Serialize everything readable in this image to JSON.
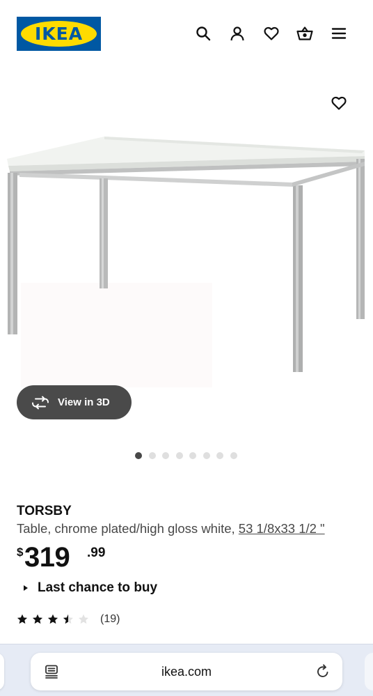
{
  "header": {
    "logo_text": "IKEA",
    "icons": [
      "search-icon",
      "account-icon",
      "heart-icon",
      "basket-icon",
      "menu-icon"
    ]
  },
  "hero": {
    "image_name": "table-product-image",
    "favorite_icon": "heart-icon",
    "view3d_label": "View in 3D",
    "view3d_icon": "rotate-3d-icon",
    "carousel": {
      "total": 8,
      "active": 1
    }
  },
  "product": {
    "name": "TORSBY",
    "description": "Table, chrome plated/high gloss white,",
    "size_link": "53 1/8x33 1/2 \"",
    "price": {
      "currency": "$",
      "integer": "319",
      "decimal": ".99"
    },
    "availability": "Last chance to buy",
    "rating": {
      "stars": 3.5,
      "max": 5,
      "count_label": "(19)"
    }
  },
  "browser": {
    "domain": "ikea.com",
    "icons": [
      "reader-menu-icon",
      "reload-icon"
    ]
  },
  "colors": {
    "ikea_blue": "#0058a3",
    "ikea_yellow": "#ffdb00",
    "text": "#111111",
    "secondary_text": "#484848",
    "view3d_bg": "#4a4a4a",
    "dot_active": "#484848",
    "dot_inactive": "#dfdfdf",
    "browser_bar": "#e6ebf5"
  }
}
